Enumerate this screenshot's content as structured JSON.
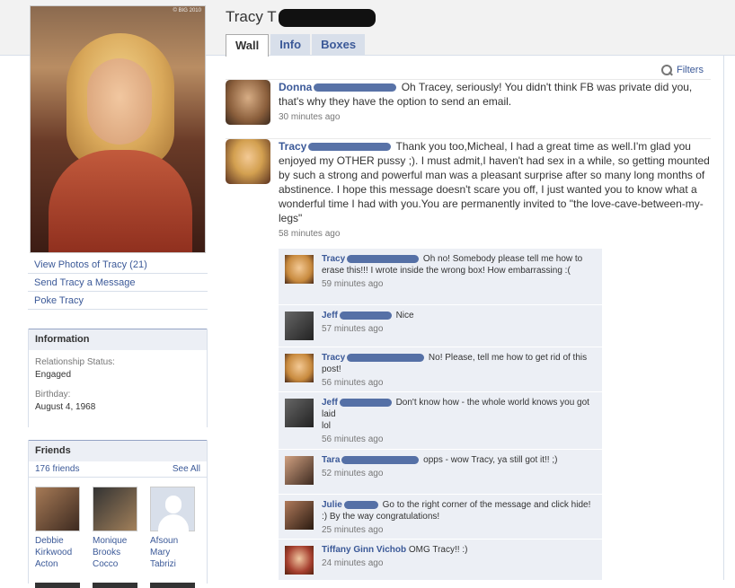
{
  "profile": {
    "name": "Tracy T",
    "photo_watermark": "© BIG 2010",
    "links": [
      "View Photos of Tracy (21)",
      "Send Tracy a Message",
      "Poke Tracy"
    ]
  },
  "tabs": [
    "Wall",
    "Info",
    "Boxes"
  ],
  "filters_label": "Filters",
  "information": {
    "title": "Information",
    "relationship_label": "Relationship Status:",
    "relationship_value": "Engaged",
    "birthday_label": "Birthday:",
    "birthday_value": "August 4, 1968"
  },
  "friends": {
    "title": "Friends",
    "count": "176 friends",
    "see_all": "See All",
    "list": [
      {
        "name": "Debbie Kirkwood Acton"
      },
      {
        "name": "Monique Brooks Cocco"
      },
      {
        "name": "Afsoun Mary Tabrizi"
      }
    ]
  },
  "wall": [
    {
      "actor": "Donna",
      "text": "Oh Tracey, seriously! You didn't think FB was private did you, that's why they have the option to send an email.",
      "time": "30 minutes ago"
    },
    {
      "actor": "Tracy",
      "text": "Thank you too,Micheal, I had a great time as well.I'm glad you enjoyed my OTHER pussy ;). I must admit,I haven't had sex in a while, so getting mounted by such a strong and powerful man was a pleasant surprise after so many long months of abstinence. I hope this message doesn't scare you off, I just wanted you to know what a wonderful time I had with you.You are permanently invited to \"the love-cave-between-my-legs\"",
      "time": "58 minutes ago"
    }
  ],
  "comments": [
    {
      "actor": "Tracy",
      "text": "Oh no! Somebody please tell me how to erase this!!! I wrote inside the wrong box! How embarrassing :(",
      "time": "59 minutes ago"
    },
    {
      "actor": "Jeff",
      "text": "Nice",
      "time": "57 minutes ago"
    },
    {
      "actor": "Tracy",
      "text": "No! Please, tell me how to get rid of this post!",
      "time": "56 minutes ago"
    },
    {
      "actor": "Jeff",
      "text": "Don't know how - the whole world knows you got laid\nlol",
      "time": "56 minutes ago"
    },
    {
      "actor": "Tara",
      "text": "opps - wow Tracy, ya still got it!! ;)",
      "time": "52 minutes ago"
    },
    {
      "actor": "Julie",
      "text": "Go to the right corner of the message and click hide! :) By the way congratulations!",
      "time": "25 minutes ago"
    },
    {
      "actor": "Tiffany Ginn Vichob",
      "text": "OMG Tracy!! :)",
      "time": "24 minutes ago"
    }
  ]
}
